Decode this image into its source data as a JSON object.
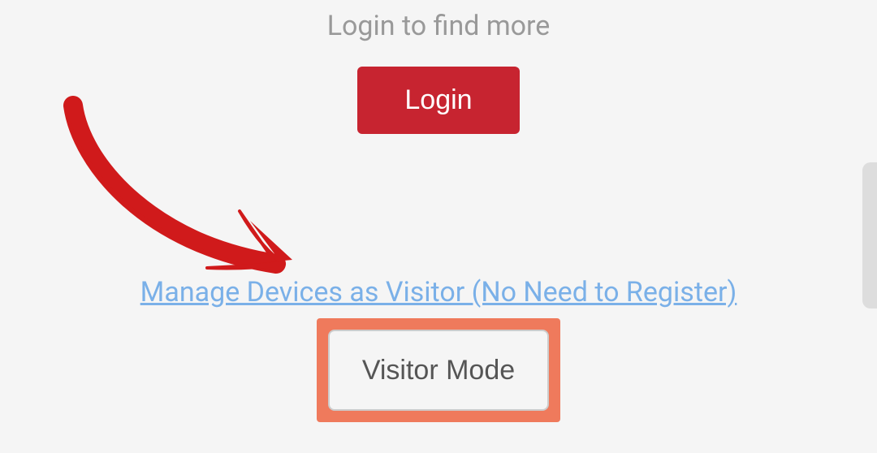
{
  "prompt": {
    "text": "Login to find more"
  },
  "buttons": {
    "login_label": "Login",
    "visitor_mode_label": "Visitor Mode"
  },
  "links": {
    "visitor_link_text": "Manage Devices as Visitor (No Need to Register)"
  },
  "colors": {
    "login_button_bg": "#c72430",
    "visitor_link_color": "#7ab0e8",
    "highlight_box": "#ef7a5c",
    "arrow_color": "#d01a1b"
  }
}
